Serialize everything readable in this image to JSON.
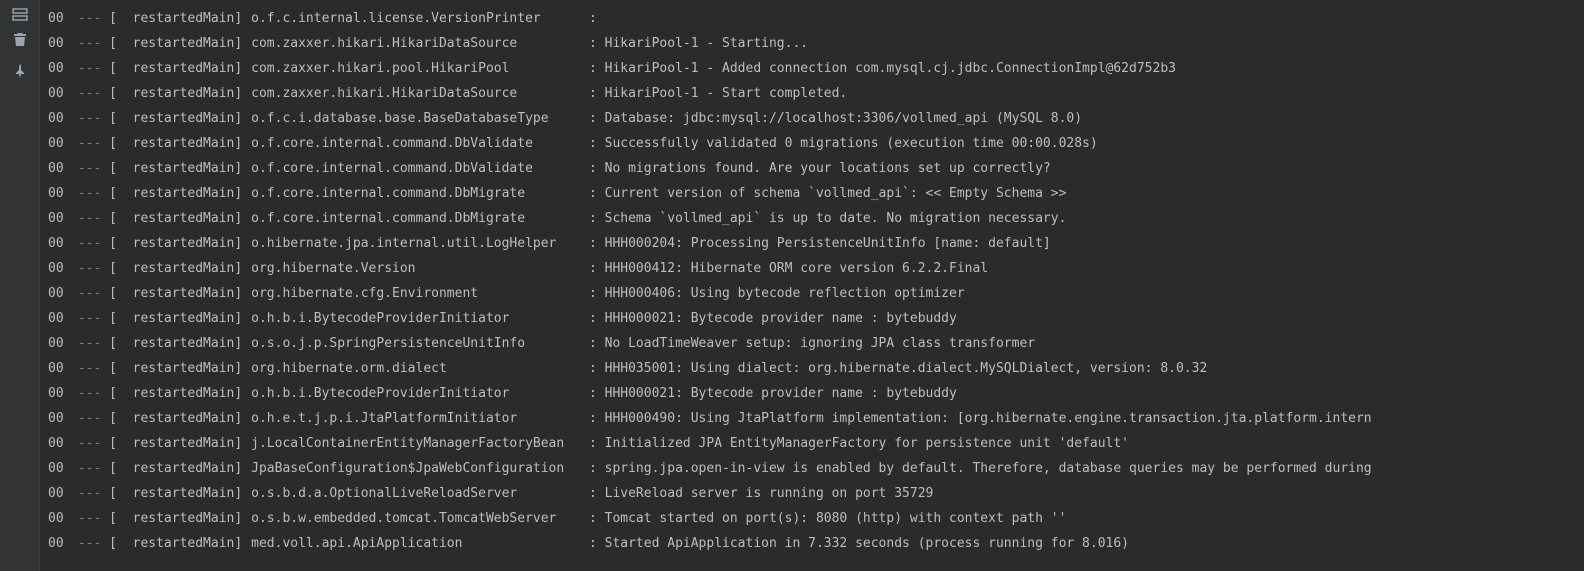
{
  "toolbar": {
    "layout_icon": "layout-icon",
    "trash_icon": "trash-icon",
    "pin_icon": "pin-icon"
  },
  "lines": [
    {
      "level": "00",
      "sep": "---",
      "thread": "[  restartedMain]",
      "logger": "o.f.c.internal.license.VersionPrinter",
      "msg": ""
    },
    {
      "level": "00",
      "sep": "---",
      "thread": "[  restartedMain]",
      "logger": "com.zaxxer.hikari.HikariDataSource",
      "msg": "HikariPool-1 - Starting..."
    },
    {
      "level": "00",
      "sep": "---",
      "thread": "[  restartedMain]",
      "logger": "com.zaxxer.hikari.pool.HikariPool",
      "msg": "HikariPool-1 - Added connection com.mysql.cj.jdbc.ConnectionImpl@62d752b3"
    },
    {
      "level": "00",
      "sep": "---",
      "thread": "[  restartedMain]",
      "logger": "com.zaxxer.hikari.HikariDataSource",
      "msg": "HikariPool-1 - Start completed."
    },
    {
      "level": "00",
      "sep": "---",
      "thread": "[  restartedMain]",
      "logger": "o.f.c.i.database.base.BaseDatabaseType",
      "msg": "Database: jdbc:mysql://localhost:3306/vollmed_api (MySQL 8.0)"
    },
    {
      "level": "00",
      "sep": "---",
      "thread": "[  restartedMain]",
      "logger": "o.f.core.internal.command.DbValidate",
      "msg": "Successfully validated 0 migrations (execution time 00:00.028s)"
    },
    {
      "level": "00",
      "sep": "---",
      "thread": "[  restartedMain]",
      "logger": "o.f.core.internal.command.DbValidate",
      "msg": "No migrations found. Are your locations set up correctly?"
    },
    {
      "level": "00",
      "sep": "---",
      "thread": "[  restartedMain]",
      "logger": "o.f.core.internal.command.DbMigrate",
      "msg": "Current version of schema `vollmed_api`: << Empty Schema >>"
    },
    {
      "level": "00",
      "sep": "---",
      "thread": "[  restartedMain]",
      "logger": "o.f.core.internal.command.DbMigrate",
      "msg": "Schema `vollmed_api` is up to date. No migration necessary."
    },
    {
      "level": "00",
      "sep": "---",
      "thread": "[  restartedMain]",
      "logger": "o.hibernate.jpa.internal.util.LogHelper",
      "msg": "HHH000204: Processing PersistenceUnitInfo [name: default]"
    },
    {
      "level": "00",
      "sep": "---",
      "thread": "[  restartedMain]",
      "logger": "org.hibernate.Version",
      "msg": "HHH000412: Hibernate ORM core version 6.2.2.Final"
    },
    {
      "level": "00",
      "sep": "---",
      "thread": "[  restartedMain]",
      "logger": "org.hibernate.cfg.Environment",
      "msg": "HHH000406: Using bytecode reflection optimizer"
    },
    {
      "level": "00",
      "sep": "---",
      "thread": "[  restartedMain]",
      "logger": "o.h.b.i.BytecodeProviderInitiator",
      "msg": "HHH000021: Bytecode provider name : bytebuddy"
    },
    {
      "level": "00",
      "sep": "---",
      "thread": "[  restartedMain]",
      "logger": "o.s.o.j.p.SpringPersistenceUnitInfo",
      "msg": "No LoadTimeWeaver setup: ignoring JPA class transformer"
    },
    {
      "level": "00",
      "sep": "---",
      "thread": "[  restartedMain]",
      "logger": "org.hibernate.orm.dialect",
      "msg": "HHH035001: Using dialect: org.hibernate.dialect.MySQLDialect, version: 8.0.32"
    },
    {
      "level": "00",
      "sep": "---",
      "thread": "[  restartedMain]",
      "logger": "o.h.b.i.BytecodeProviderInitiator",
      "msg": "HHH000021: Bytecode provider name : bytebuddy"
    },
    {
      "level": "00",
      "sep": "---",
      "thread": "[  restartedMain]",
      "logger": "o.h.e.t.j.p.i.JtaPlatformInitiator",
      "msg": "HHH000490: Using JtaPlatform implementation: [org.hibernate.engine.transaction.jta.platform.intern"
    },
    {
      "level": "00",
      "sep": "---",
      "thread": "[  restartedMain]",
      "logger": "j.LocalContainerEntityManagerFactoryBean",
      "msg": "Initialized JPA EntityManagerFactory for persistence unit 'default'"
    },
    {
      "level": "00",
      "sep": "---",
      "thread": "[  restartedMain]",
      "logger": "JpaBaseConfiguration$JpaWebConfiguration",
      "msg": "spring.jpa.open-in-view is enabled by default. Therefore, database queries may be performed during"
    },
    {
      "level": "00",
      "sep": "---",
      "thread": "[  restartedMain]",
      "logger": "o.s.b.d.a.OptionalLiveReloadServer",
      "msg": "LiveReload server is running on port 35729"
    },
    {
      "level": "00",
      "sep": "---",
      "thread": "[  restartedMain]",
      "logger": "o.s.b.w.embedded.tomcat.TomcatWebServer",
      "msg": "Tomcat started on port(s): 8080 (http) with context path ''"
    },
    {
      "level": "00",
      "sep": "---",
      "thread": "[  restartedMain]",
      "logger": "med.voll.api.ApiApplication",
      "msg": "Started ApiApplication in 7.332 seconds (process running for 8.016)"
    }
  ]
}
